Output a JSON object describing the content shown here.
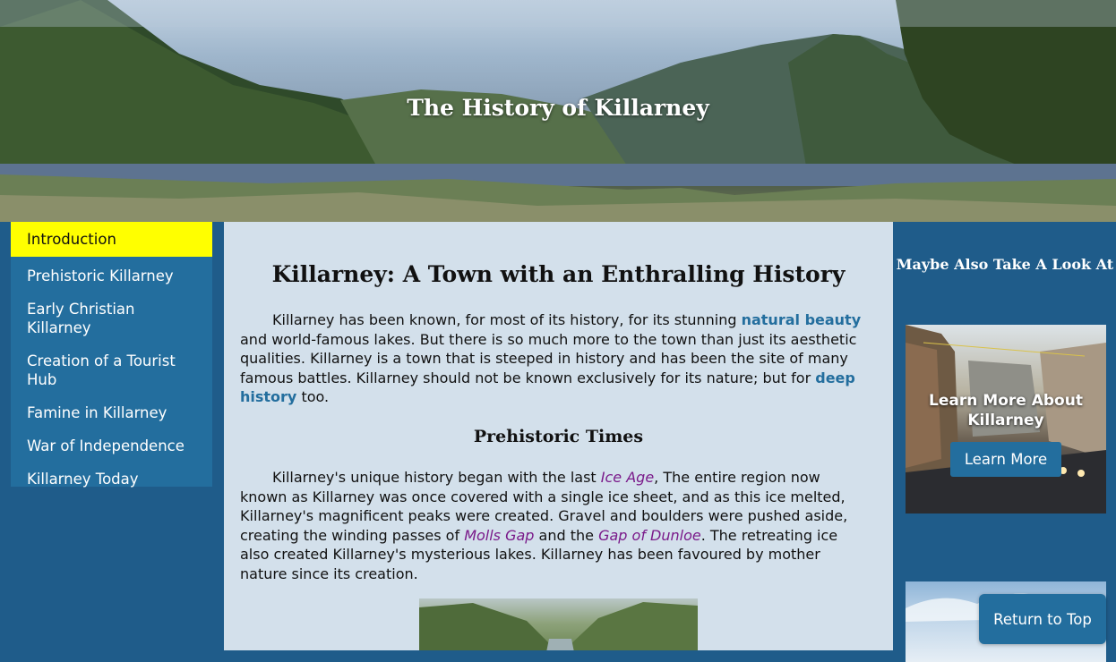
{
  "hero": {
    "title": "The History of Killarney"
  },
  "nav": {
    "items": [
      {
        "label": "Introduction",
        "active": true
      },
      {
        "label": "Prehistoric Killarney"
      },
      {
        "label": "Early Christian Killarney"
      },
      {
        "label": "Creation of a Tourist Hub"
      },
      {
        "label": "Famine in Killarney"
      },
      {
        "label": "War of Independence"
      },
      {
        "label": "Killarney Today"
      }
    ]
  },
  "main": {
    "heading": "Killarney: A Town with an Enthralling History",
    "intro": {
      "t1": "Killarney has been known, for most of its history, for its stunning ",
      "link1": "natural beauty",
      "t2": " and world-famous lakes. But there is so much more to the town than just its aesthetic qualities. Killarney is a town that is steeped in history and has been the site of many famous battles. Killarney should not be known exclusively for its nature; but for ",
      "link2": "deep history",
      "t3": " too."
    },
    "subheading": "Prehistoric Times",
    "prehistoric": {
      "t1": "Killarney's unique history began with the last ",
      "link1": "Ice Age",
      "t2": ", The entire region now known as Killarney was once covered with a single ice sheet, and as this ice melted, Killarney's magnificent peaks were created. Gravel and boulders were pushed aside, creating the winding passes of ",
      "link2": "Molls Gap",
      "t3": " and the ",
      "link3": "Gap of Dunloe",
      "t4": ". The retreating ice also created Killarney's mysterious lakes. Killarney has been favoured by mother nature since its creation."
    }
  },
  "aside": {
    "title": "Maybe Also Take A Look At",
    "card_title": "Learn More About Killarney",
    "card_button": "Learn More"
  },
  "return_button": "Return to Top",
  "colors": {
    "accent": "#236e9e",
    "page_bg": "#1f5c8a",
    "content_bg": "#d3e0eb",
    "active_nav": "#ffff00",
    "italic_link": "#7a1a8a"
  }
}
